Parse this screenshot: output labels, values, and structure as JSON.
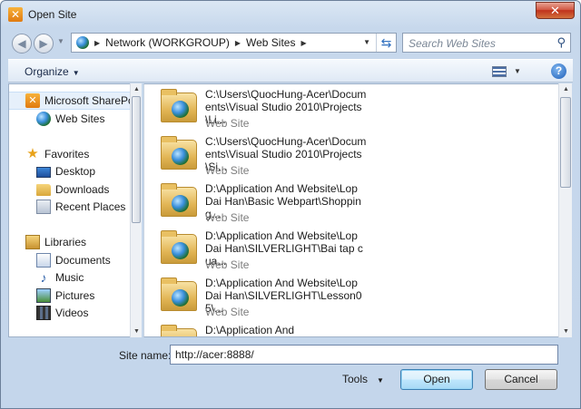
{
  "window": {
    "title": "Open Site",
    "close_glyph": "✕"
  },
  "address_bar": {
    "crumbs": [
      "Network (WORKGROUP)",
      "Web Sites"
    ],
    "search_placeholder": "Search Web Sites"
  },
  "command_bar": {
    "organize_label": "Organize"
  },
  "sidebar": {
    "items": [
      {
        "label": "Microsoft SharePoint Sites",
        "icon": "sharepoint-icon"
      },
      {
        "label": "Web Sites",
        "icon": "globe-icon"
      },
      {
        "label": "Favorites",
        "icon": "star-icon"
      },
      {
        "label": "Desktop",
        "icon": "desktop-icon"
      },
      {
        "label": "Downloads",
        "icon": "downloads-folder-icon"
      },
      {
        "label": "Recent Places",
        "icon": "recent-places-icon"
      },
      {
        "label": "Libraries",
        "icon": "libraries-icon"
      },
      {
        "label": "Documents",
        "icon": "documents-icon"
      },
      {
        "label": "Music",
        "icon": "music-icon"
      },
      {
        "label": "Pictures",
        "icon": "pictures-icon"
      },
      {
        "label": "Videos",
        "icon": "videos-icon"
      }
    ]
  },
  "files": [
    {
      "name": "C:\\Users\\QuocHung-Acer\\Documents\\Visual Studio 2010\\Projects\\Li...",
      "type": "Web Site"
    },
    {
      "name": "C:\\Users\\QuocHung-Acer\\Documents\\Visual Studio 2010\\Projects\\Si...",
      "type": "Web Site"
    },
    {
      "name": "D:\\Application And Website\\Lop Dai Han\\Basic Webpart\\Shopping...",
      "type": "Web Site"
    },
    {
      "name": "D:\\Application And Website\\Lop Dai Han\\SILVERLIGHT\\Bai tap cua...",
      "type": "Web Site"
    },
    {
      "name": "D:\\Application And Website\\Lop Dai Han\\SILVERLIGHT\\Lesson05\\...",
      "type": "Web Site"
    },
    {
      "name": "D:\\Application And",
      "type": ""
    }
  ],
  "footer": {
    "site_name_label": "Site name:",
    "site_name_value": "http://acer:8888/",
    "tools_label": "Tools",
    "open_label": "Open",
    "cancel_label": "Cancel"
  }
}
